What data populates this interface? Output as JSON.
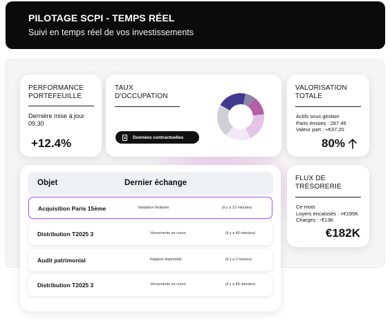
{
  "header": {
    "title": "PILOTAGE SCPI - TEMPS RÉEL",
    "subtitle": "Suivi en temps réel de vos investissements"
  },
  "performance": {
    "label": "PERFORMANCE PORTEFEUILLE",
    "updated": "Dernière mise à jour 09.30",
    "value": "+12.4%"
  },
  "occupation": {
    "label": "TAUX D'OCCUPATION",
    "button_label": "Données contractuelles",
    "button_icon": "document-icon",
    "donut_colors": [
      "#3f3a8f",
      "#8b86a6",
      "#b25fa6",
      "#e3c4e8",
      "#f1e9f6",
      "#cfcfd6"
    ]
  },
  "valorisation": {
    "label": "VALORISATION TOTALE",
    "lines": [
      "Actifs sous gestion",
      "Parts émises : 287 45",
      "Valeur part : +€37.20"
    ],
    "value": "80%",
    "trend_icon": "arrow-up-icon"
  },
  "flux": {
    "label": "FLUX DE TRÉSORERIE",
    "lines": [
      "Ce mois",
      "Loyers encaissés : +€195K",
      "Charges : -€13K"
    ],
    "value": "€182K"
  },
  "table": {
    "col_object": "Objet",
    "col_last": "Dernier échange",
    "rows": [
      {
        "object": "Acquisition Paris 15ème",
        "status": "Validation finalisée",
        "time": "(il y a 12 minutes)"
      },
      {
        "object": "Distribution T2025 3",
        "status": "Versements en cours",
        "time": "(il y a 45 minutes)"
      },
      {
        "object": "Audit patrimonial",
        "status": "Rapport disponible",
        "time": "(il y a 2 heures)"
      },
      {
        "object": "Distribution T2025 3",
        "status": "Versements en cours",
        "time": "(il y a 45 minutes)"
      }
    ]
  },
  "accent_color": "#9b5fd6"
}
